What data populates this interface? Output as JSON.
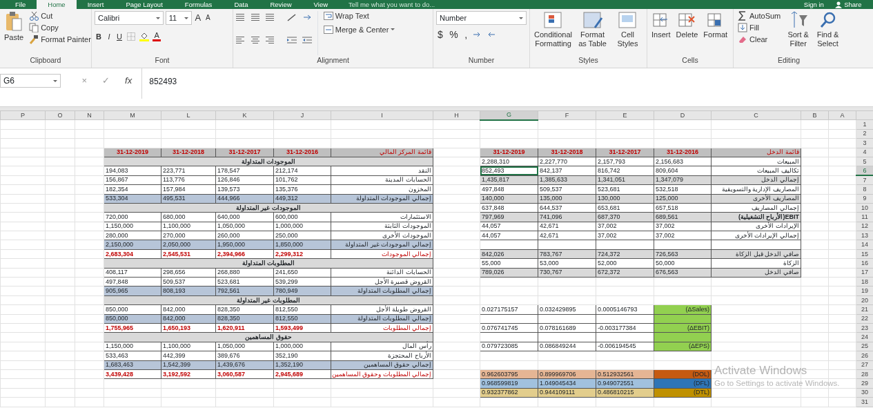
{
  "ribbon": {
    "tabs": [
      {
        "label": "File",
        "selected": false
      },
      {
        "label": "Home",
        "selected": true
      },
      {
        "label": "Insert",
        "selected": false
      },
      {
        "label": "Page Layout",
        "selected": false
      },
      {
        "label": "Formulas",
        "selected": false
      },
      {
        "label": "Data",
        "selected": false
      },
      {
        "label": "Review",
        "selected": false
      },
      {
        "label": "View",
        "selected": false
      }
    ],
    "tell_me": "Tell me what you want to do...",
    "sign_in": "Sign in",
    "share": "Share",
    "clipboard": {
      "label": "Clipboard",
      "paste": "Paste",
      "items": [
        "Cut",
        "Copy",
        "Format Painter"
      ]
    },
    "font": {
      "label": "Font",
      "name": "Calibri",
      "size": "11",
      "grow": "A",
      "shrink": "A",
      "styles": [
        "B",
        "I",
        "U"
      ],
      "color_letter": "A"
    },
    "alignment": {
      "label": "Alignment",
      "wrap": "Wrap Text",
      "merge": "Merge & Center"
    },
    "number": {
      "label": "Number",
      "format": "Number",
      "symbols": [
        "$",
        "%",
        ","
      ]
    },
    "styles": {
      "label": "Styles",
      "buttons": [
        "Conditional Formatting",
        "Format as Table",
        "Cell Styles"
      ]
    },
    "cells": {
      "label": "Cells",
      "buttons": [
        "Insert",
        "Delete",
        "Format"
      ]
    },
    "editing": {
      "label": "Editing",
      "items": [
        "AutoSum",
        "Fill",
        "Clear"
      ],
      "buttons": [
        "Sort & Filter",
        "Find & Select"
      ]
    }
  },
  "formula_bar": {
    "name_box": "G6",
    "cancel": "×",
    "enter": "✓",
    "fx": "fx",
    "value": "852493"
  },
  "sheet": {
    "columns": [
      "P",
      "O",
      "N",
      "M",
      "L",
      "K",
      "J",
      "I",
      "H",
      "G",
      "F",
      "E",
      "D",
      "C",
      "B",
      "A"
    ],
    "rows": [
      "1",
      "2",
      "3",
      "4",
      "5",
      "6",
      "7",
      "8",
      "9",
      "10",
      "11",
      "12",
      "13",
      "14",
      "15",
      "16",
      "17",
      "18",
      "19",
      "20",
      "21",
      "22",
      "23",
      "24",
      "25",
      "26",
      "27",
      "28",
      "29",
      "30",
      "31"
    ]
  },
  "balance_sheet": {
    "title": "قائمة المركز المالي",
    "dates": [
      "31-12-2019",
      "31-12-2018",
      "31-12-2017",
      "31-12-2016"
    ],
    "rows": [
      {
        "kind": "section",
        "label": "الموجودات المتداولة"
      },
      {
        "kind": "item",
        "label": "النقد",
        "values": [
          "194,083",
          "223,771",
          "178,547",
          "212,174"
        ]
      },
      {
        "kind": "item",
        "label": "الحسابات المدينة",
        "values": [
          "156,867",
          "113,776",
          "126,846",
          "101,762"
        ]
      },
      {
        "kind": "item",
        "label": "المخزون",
        "values": [
          "182,354",
          "157,984",
          "139,573",
          "135,376"
        ]
      },
      {
        "kind": "subtotal",
        "label": "إجمالي الموجودات المتداولة",
        "values": [
          "533,304",
          "495,531",
          "444,966",
          "449,312"
        ]
      },
      {
        "kind": "section",
        "label": "الموجودات غير المتداولة"
      },
      {
        "kind": "item",
        "label": "الاستثمارات",
        "values": [
          "720,000",
          "680,000",
          "640,000",
          "600,000"
        ]
      },
      {
        "kind": "item",
        "label": "الموجودات الثابتة",
        "values": [
          "1,150,000",
          "1,100,000",
          "1,050,000",
          "1,000,000"
        ]
      },
      {
        "kind": "item",
        "label": "الموجودات الأخرى",
        "values": [
          "280,000",
          "270,000",
          "260,000",
          "250,000"
        ]
      },
      {
        "kind": "subtotal",
        "label": "إجمالي الموجودات غير المتداولة",
        "values": [
          "2,150,000",
          "2,050,000",
          "1,950,000",
          "1,850,000"
        ]
      },
      {
        "kind": "total",
        "label": "إجمالي الموجودات",
        "values": [
          "2,683,304",
          "2,545,531",
          "2,394,966",
          "2,299,312"
        ]
      },
      {
        "kind": "section",
        "label": "المطلوبات المتداولة"
      },
      {
        "kind": "item",
        "label": "الحسابات الدائنة",
        "values": [
          "408,117",
          "298,656",
          "268,880",
          "241,650"
        ]
      },
      {
        "kind": "item",
        "label": "القروض قصيرة الأجل",
        "values": [
          "497,848",
          "509,537",
          "523,681",
          "539,299"
        ]
      },
      {
        "kind": "subtotal",
        "label": "إجمالي المطلوبات المتداولة",
        "values": [
          "905,965",
          "808,193",
          "792,561",
          "780,949"
        ]
      },
      {
        "kind": "section",
        "label": "المطلوبات غير المتداولة"
      },
      {
        "kind": "item",
        "label": "القروض طويلة الأجل",
        "values": [
          "850,000",
          "842,000",
          "828,350",
          "812,550"
        ]
      },
      {
        "kind": "subtotal",
        "label": "إجمالي المطلوبات المتداولة",
        "values": [
          "850,000",
          "842,000",
          "828,350",
          "812,550"
        ]
      },
      {
        "kind": "total",
        "label": "إجمالي المطلوبات",
        "values": [
          "1,755,965",
          "1,650,193",
          "1,620,911",
          "1,593,499"
        ]
      },
      {
        "kind": "section",
        "label": "حقوق المساهمين"
      },
      {
        "kind": "item",
        "label": "رأس المال",
        "values": [
          "1,150,000",
          "1,100,000",
          "1,050,000",
          "1,000,000"
        ]
      },
      {
        "kind": "item",
        "label": "الأرباح المحتجزة",
        "values": [
          "533,463",
          "442,399",
          "389,676",
          "352,190"
        ]
      },
      {
        "kind": "subtotal",
        "label": "إجمالي حقوق المساهمين",
        "values": [
          "1,683,463",
          "1,542,399",
          "1,439,676",
          "1,352,190"
        ]
      },
      {
        "kind": "total",
        "label": "إجمالي المطلوبات وحقوق المساهمين",
        "values": [
          "3,439,428",
          "3,192,592",
          "3,060,587",
          "2,945,689"
        ]
      }
    ]
  },
  "income_statement": {
    "title": "قائمة الدخل",
    "dates": [
      "31-12-2019",
      "31-12-2018",
      "31-12-2017",
      "31-12-2016"
    ],
    "rows": [
      {
        "kind": "item",
        "shaded": false,
        "selected": false,
        "label": "المبيعات",
        "values": [
          "2,288,310",
          "2,227,770",
          "2,157,793",
          "2,156,683"
        ]
      },
      {
        "kind": "item",
        "shaded": false,
        "selected": true,
        "label": "تكاليف المبيعات",
        "values": [
          "852,493",
          "842,137",
          "816,742",
          "809,604"
        ]
      },
      {
        "kind": "item",
        "shaded": true,
        "selected": false,
        "label": "إجمالي الدخل",
        "values": [
          "1,435,817",
          "1,385,633",
          "1,341,051",
          "1,347,079"
        ]
      },
      {
        "kind": "item",
        "shaded": false,
        "selected": false,
        "label": "المصاريف الإدارية والتسويقية",
        "values": [
          "497,848",
          "509,537",
          "523,681",
          "532,518"
        ]
      },
      {
        "kind": "item",
        "shaded": true,
        "selected": false,
        "label": "المصاريف الأخرى",
        "values": [
          "140,000",
          "135,000",
          "130,000",
          "125,000"
        ]
      },
      {
        "kind": "item",
        "shaded": false,
        "selected": false,
        "label": "إجمالي المصاريف",
        "values": [
          "637,848",
          "644,537",
          "653,681",
          "657,518"
        ]
      },
      {
        "kind": "key",
        "shaded": true,
        "selected": false,
        "label": "EBIT(الأرباح التشغيلية)",
        "values": [
          "797,969",
          "741,096",
          "687,370",
          "689,561"
        ]
      },
      {
        "kind": "item",
        "shaded": false,
        "selected": false,
        "label": "الإيرادات الأخرى",
        "values": [
          "44,057",
          "42,671",
          "37,002",
          "37,002"
        ]
      },
      {
        "kind": "item",
        "shaded": false,
        "selected": false,
        "label": "إجمالي الإيرادات الأخرى",
        "values": [
          "44,057",
          "42,671",
          "37,002",
          "37,002"
        ]
      },
      {
        "kind": "blank",
        "shaded": false,
        "selected": false
      },
      {
        "kind": "item",
        "shaded": true,
        "selected": false,
        "label": "صافي الدخل قبل الزكاة",
        "values": [
          "842,026",
          "783,767",
          "724,372",
          "726,563"
        ]
      },
      {
        "kind": "item",
        "shaded": false,
        "selected": false,
        "label": "الزكاة",
        "values": [
          "55,000",
          "53,000",
          "52,000",
          "50,000"
        ]
      },
      {
        "kind": "item",
        "shaded": true,
        "selected": false,
        "label": "صافي الدخل",
        "values": [
          "789,026",
          "730,767",
          "672,372",
          "676,563"
        ]
      }
    ]
  },
  "changes": [
    {
      "kind": "change",
      "label": "(ΔSales)",
      "values": [
        "0.027175157",
        "0.032429895",
        "0.0005146793"
      ]
    },
    {
      "kind": "spacer"
    },
    {
      "kind": "change",
      "label": "(ΔEBIT)",
      "values": [
        "0.076741745",
        "0.078161689",
        "-0.003177384"
      ]
    },
    {
      "kind": "spacer"
    },
    {
      "kind": "change",
      "label": "(ΔEPS)",
      "values": [
        "0.079723085",
        "0.086849244",
        "-0.006194545"
      ]
    }
  ],
  "leverage": [
    {
      "label": "(DOL)",
      "color": "#c55a11",
      "values": [
        "0.962603795",
        "0.899969706",
        "0.512932561"
      ]
    },
    {
      "label": "(DFL)",
      "color": "#2e75b6",
      "values": [
        "0.968599819",
        "1.049045434",
        "0.949072551"
      ]
    },
    {
      "label": "(DTL)",
      "color": "#bf9000",
      "values": [
        "0.932377862",
        "0.944109111",
        "0.486810215"
      ]
    }
  ],
  "os_notice": {
    "title": "Activate Windows",
    "text": "Go to Settings to activate Windows."
  }
}
